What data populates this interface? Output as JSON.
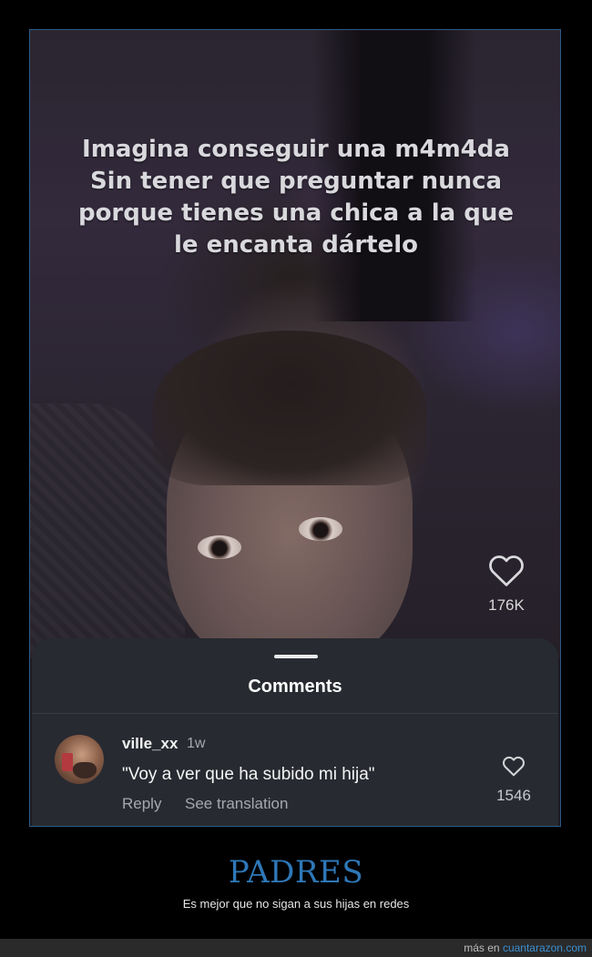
{
  "video": {
    "caption": "Imagina conseguir una m4m4da Sin tener que preguntar nunca porque tienes una chica a la que le encanta dártelo",
    "like_icon": "heart-outline-icon",
    "like_count": "176K"
  },
  "comments_sheet": {
    "title": "Comments",
    "comments": [
      {
        "username": "ville_xx",
        "time": "1w",
        "text": "\"Voy a ver que ha subido mi hija\"",
        "reply_label": "Reply",
        "translate_label": "See translation",
        "like_icon": "heart-outline-icon",
        "like_count": "1546"
      }
    ]
  },
  "footer": {
    "title": "PADRES",
    "subtitle": "Es mejor que no sigan a sus hijas en redes",
    "credit_prefix": "más en",
    "credit_site": "cuantarazon.com"
  },
  "colors": {
    "frame_border": "#2b5a86",
    "sheet_bg": "#272a31",
    "footer_title": "#2e78b8",
    "credit_link": "#3b8ed0"
  }
}
